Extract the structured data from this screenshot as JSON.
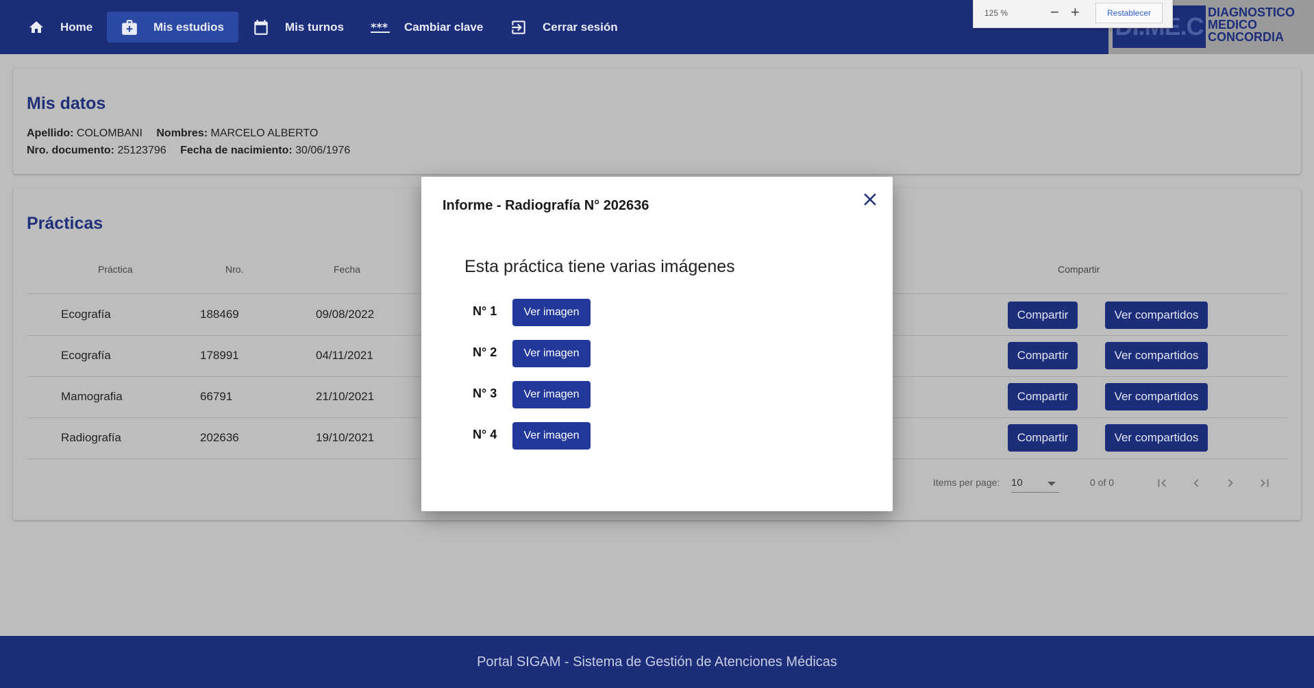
{
  "nav": {
    "home": "Home",
    "mis_estudios": "Mis estudios",
    "mis_turnos": "Mis turnos",
    "cambiar_clave": "Cambiar clave",
    "cerrar_sesion": "Cerrar sesión"
  },
  "zoom": {
    "level": "125 %",
    "minus": "−",
    "plus": "+",
    "reset": "Restablecer"
  },
  "logo": {
    "mark": "DI.ME.C",
    "line1": "DIAGNOSTICO",
    "line2": "MEDICO",
    "line3": "CONCORDIA"
  },
  "mis_datos": {
    "title": "Mis datos",
    "apellido_label": "Apellido:",
    "apellido": "COLOMBANI",
    "nombres_label": "Nombres:",
    "nombres": "MARCELO ALBERTO",
    "documento_label": "Nro. documento:",
    "documento": "25123796",
    "nacimiento_label": "Fecha de nacimiento:",
    "nacimiento": "30/06/1976"
  },
  "practicas": {
    "title": "Prácticas",
    "headers": {
      "practica": "Práctica",
      "nro": "Nro.",
      "fecha": "Fecha",
      "compartir": "Compartir"
    },
    "rows": [
      {
        "practica": "Ecografía",
        "nro": "188469",
        "fecha": "09/08/2022"
      },
      {
        "practica": "Ecografía",
        "nro": "178991",
        "fecha": "04/11/2021"
      },
      {
        "practica": "Mamografia",
        "nro": "66791",
        "fecha": "21/10/2021"
      },
      {
        "practica": "Radiografía",
        "nro": "202636",
        "fecha": "19/10/2021"
      }
    ],
    "btn_compartir": "Compartir",
    "btn_ver_compartidos": "Ver compartidos",
    "paginator": {
      "items_label": "Items per page:",
      "page_size": "10",
      "range": "0 of 0"
    }
  },
  "modal": {
    "title": "Informe - Radiografía N° 202636",
    "subtitle": "Esta práctica tiene varias imágenes",
    "images": [
      {
        "label": "N° 1",
        "button": "Ver imagen"
      },
      {
        "label": "N° 2",
        "button": "Ver imagen"
      },
      {
        "label": "N° 3",
        "button": "Ver imagen"
      },
      {
        "label": "N° 4",
        "button": "Ver imagen"
      }
    ]
  },
  "footer": {
    "text": "Portal SIGAM - Sistema de Gestión de Atenciones Médicas"
  },
  "colors": {
    "primary": "#1c2e7a",
    "button": "#23399a",
    "overlay_bg": "#bdbdbd"
  }
}
